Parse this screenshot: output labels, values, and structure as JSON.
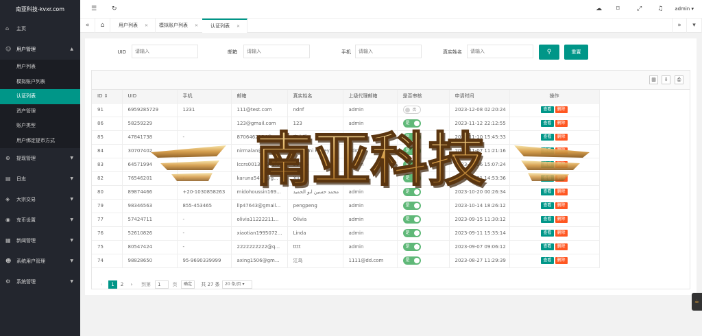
{
  "sidebar": {
    "logo": "南亚科技-kvxr.com",
    "home": "主页",
    "user_mgmt": "用户管理",
    "sub_items": [
      {
        "label": "用户列表"
      },
      {
        "label": "模拟账户列表"
      },
      {
        "label": "认证列表"
      },
      {
        "label": "资产管理"
      },
      {
        "label": "账户类型"
      },
      {
        "label": "用户绑定提币方式"
      }
    ],
    "groups": [
      {
        "label": "提现管理"
      },
      {
        "label": "日志"
      },
      {
        "label": "大宗交易"
      },
      {
        "label": "充币设置"
      },
      {
        "label": "新闻管理"
      },
      {
        "label": "系统用户管理"
      },
      {
        "label": "系统管理"
      }
    ]
  },
  "header": {
    "admin": "admin"
  },
  "tabs": [
    {
      "label": "用户列表"
    },
    {
      "label": "模拟账户列表"
    },
    {
      "label": "认证列表"
    }
  ],
  "search": {
    "uid_label": "UID",
    "email_label": "邮箱",
    "phone_label": "手机",
    "name_label": "真实姓名",
    "placeholder": "请输入",
    "reset": "重置"
  },
  "table": {
    "columns": [
      "ID",
      "UID",
      "手机",
      "邮箱",
      "真实姓名",
      "上级代理邮箱",
      "是否审核",
      "申请时间",
      "操作"
    ],
    "view_label": "查看",
    "delete_label": "删除",
    "switch_on": "是",
    "switch_off": "否",
    "rows": [
      {
        "id": "91",
        "uid": "6959285729",
        "phone": "1231",
        "email": "111@test.com",
        "name": "ndnf",
        "agent": "admin",
        "approved": false,
        "time": "2023-12-08 02:20:24"
      },
      {
        "id": "86",
        "uid": "58259229",
        "phone": "",
        "email": "123@gmail.com",
        "name": "123",
        "agent": "admin",
        "approved": true,
        "time": "2023-11-12 22:12:55"
      },
      {
        "id": "85",
        "uid": "47841738",
        "phone": "-",
        "email": "8706462154@...",
        "name": "李文哲",
        "agent": "admin",
        "approved": true,
        "time": "2023-11-10 15:45:33"
      },
      {
        "id": "84",
        "uid": "30707402",
        "phone": "",
        "email": "nirmalan@gmail...",
        "name": "Pabodini Kavey",
        "agent": "admin",
        "approved": true,
        "time": "2023-11-07 11:21:16"
      },
      {
        "id": "83",
        "uid": "64571994",
        "phone": "",
        "email": "lccrs0013123co...",
        "name": "55665",
        "agent": "admin",
        "approved": true,
        "time": "2023-11-06 15:07:24"
      },
      {
        "id": "82",
        "uid": "76546201",
        "phone": "-",
        "email": "karuna5456@g...",
        "name": "Xu fei",
        "agent": "admin",
        "approved": true,
        "time": "2023-10-31 14:53:36"
      },
      {
        "id": "80",
        "uid": "89874466",
        "phone": "+20-1030858263",
        "email": "midohoussin169...",
        "name": "محمد حسين ابو الحميد",
        "agent": "admin",
        "approved": true,
        "time": "2023-10-20 00:26:34"
      },
      {
        "id": "79",
        "uid": "98346563",
        "phone": "855-453465",
        "email": "llp47643@gmail...",
        "name": "pengpeng",
        "agent": "admin",
        "approved": true,
        "time": "2023-10-14 18:26:12"
      },
      {
        "id": "77",
        "uid": "57424711",
        "phone": "-",
        "email": "olivia11222211...",
        "name": "Olivia",
        "agent": "admin",
        "approved": true,
        "time": "2023-09-15 11:30:12"
      },
      {
        "id": "76",
        "uid": "52610826",
        "phone": "-",
        "email": "xiaotian1995072...",
        "name": "Linda",
        "agent": "admin",
        "approved": true,
        "time": "2023-09-11 15:35:14"
      },
      {
        "id": "75",
        "uid": "80547424",
        "phone": "-",
        "email": "2222222222@q...",
        "name": "tttt",
        "agent": "admin",
        "approved": true,
        "time": "2023-09-07 09:06:12"
      },
      {
        "id": "74",
        "uid": "98828650",
        "phone": "95-9690339999",
        "email": "axing1506@gm...",
        "name": "江鸟",
        "agent": "1111@dd.com",
        "approved": true,
        "time": "2023-08-27 11:29:39"
      }
    ]
  },
  "pager": {
    "page1": "1",
    "page2": "2",
    "goto_prefix": "到第",
    "goto_value": "1",
    "goto_suffix": "页",
    "confirm": "确定",
    "total": "共 27 条",
    "per_page": "20 条/页"
  },
  "watermark": {
    "text": "南亚科技"
  },
  "colors": {
    "sidebar_bg": "#23262e",
    "accent": "#009688",
    "danger": "#ff5722",
    "switch_on": "#5fb878"
  }
}
